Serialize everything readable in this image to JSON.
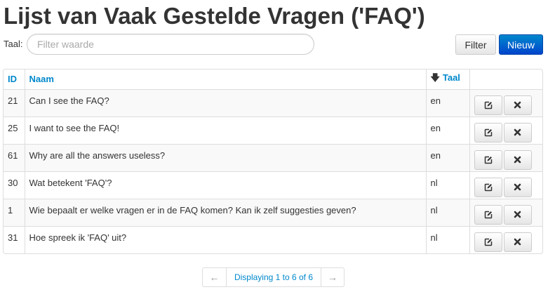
{
  "page": {
    "title": "Lijst van Vaak Gestelde Vragen ('FAQ')"
  },
  "filter": {
    "label": "Taal:",
    "placeholder": "Filter waarde",
    "value": ""
  },
  "buttons": {
    "filter": "Filter",
    "new": "Nieuw"
  },
  "table": {
    "columns": {
      "id": "ID",
      "name": "Naam",
      "lang": "Taal"
    },
    "sort_icon": "arrow-down-icon",
    "rows": [
      {
        "id": "21",
        "name": "Can I see the FAQ?",
        "lang": "en"
      },
      {
        "id": "25",
        "name": "I want to see the FAQ!",
        "lang": "en"
      },
      {
        "id": "61",
        "name": "Why are all the answers useless?",
        "lang": "en"
      },
      {
        "id": "30",
        "name": "Wat betekent 'FAQ'?",
        "lang": "nl"
      },
      {
        "id": "1",
        "name": "Wie bepaalt er welke vragen er in de FAQ komen? Kan ik zelf suggesties geven?",
        "lang": "nl"
      },
      {
        "id": "31",
        "name": "Hoe spreek ik 'FAQ' uit?",
        "lang": "nl"
      }
    ],
    "row_actions": [
      "edit-icon",
      "delete-icon"
    ]
  },
  "pagination": {
    "prev": "←",
    "info": "Displaying 1 to 6 of 6",
    "next": "→"
  },
  "colors": {
    "link": "#0088cc",
    "primary": "#0055cc"
  }
}
